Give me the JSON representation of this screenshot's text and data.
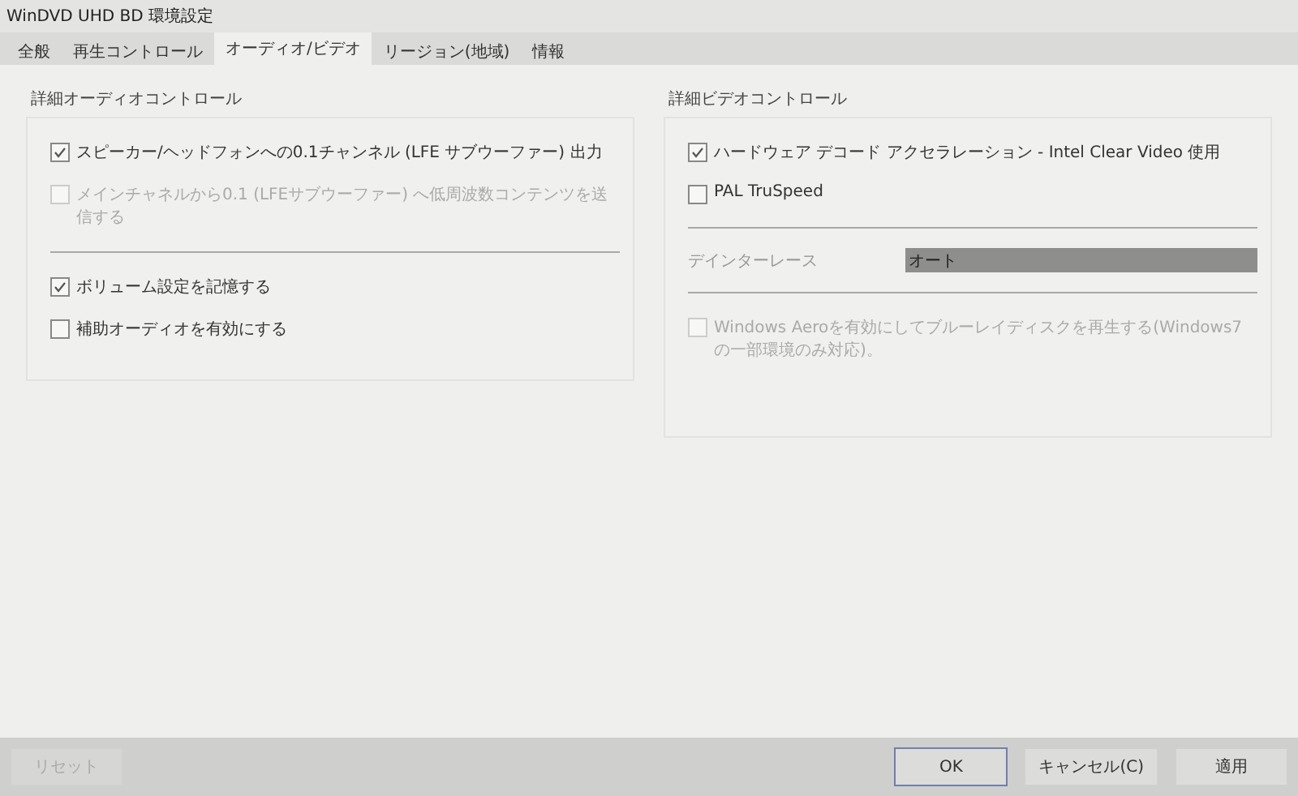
{
  "window": {
    "title": "WinDVD UHD BD 環境設定"
  },
  "tabs": [
    {
      "label": "全般",
      "selected": false
    },
    {
      "label": "再生コントロール",
      "selected": false
    },
    {
      "label": "オーディオ/ビデオ",
      "selected": true
    },
    {
      "label": "リージョン(地域)",
      "selected": false
    },
    {
      "label": "情報",
      "selected": false
    }
  ],
  "groups": [
    {
      "title": "詳細オーディオコントロール",
      "items": [
        {
          "kind": "checkbox",
          "label": "スピーカー/ヘッドフォンへの0.1チャンネル (LFE サブウーファー) 出力",
          "checked": true,
          "disabled": false
        },
        {
          "kind": "checkbox",
          "label": "メインチャネルから0.1 (LFEサブウーファー) へ低周波数コンテンツを送信する",
          "checked": false,
          "disabled": true
        },
        {
          "kind": "separator"
        },
        {
          "kind": "checkbox",
          "label": "ボリューム設定を記憶する",
          "checked": true,
          "disabled": false
        },
        {
          "kind": "checkbox",
          "label": "補助オーディオを有効にする",
          "checked": false,
          "disabled": false
        }
      ]
    },
    {
      "title": "詳細ビデオコントロール",
      "items": [
        {
          "kind": "checkbox",
          "label": "ハードウェア デコード アクセラレーション - Intel Clear Video 使用",
          "checked": true,
          "disabled": false
        },
        {
          "kind": "checkbox",
          "label": "PAL TruSpeed",
          "checked": false,
          "disabled": false
        },
        {
          "kind": "separator"
        },
        {
          "kind": "dropdown",
          "label": "デインターレース",
          "value": "オート",
          "disabled": true
        },
        {
          "kind": "separator"
        },
        {
          "kind": "checkbox",
          "label": "Windows Aeroを有効にしてブルーレイディスクを再生する(Windows7の一部環境のみ対応)。",
          "checked": false,
          "disabled": true
        }
      ]
    }
  ],
  "buttons": [
    {
      "label": "リセット",
      "disabled": true,
      "default": false
    },
    {
      "label": "OK",
      "disabled": false,
      "default": true
    },
    {
      "label": "キャンセル(C)",
      "disabled": false,
      "default": false
    },
    {
      "label": "適用",
      "disabled": false,
      "default": false
    }
  ]
}
